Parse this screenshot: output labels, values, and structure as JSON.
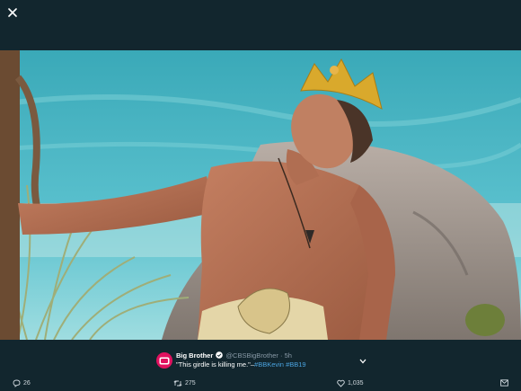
{
  "topbar": {
    "close_icon": "close-icon"
  },
  "tweet": {
    "author_name": "Big Brother",
    "handle": "@CBSBigBrother",
    "separator": "·",
    "time": "5h",
    "text": "\"This girdle is killing me.\"–",
    "hashtags": [
      "#BBKevin",
      "#BB19"
    ],
    "avatar_icon": "tv-logo-icon",
    "verified_icon": "verified-badge-icon",
    "menu_icon": "chevron-down-icon"
  },
  "actions": {
    "reply_count": "26",
    "retweet_count": "275",
    "like_count": "1,035",
    "reply_icon": "reply-icon",
    "retweet_icon": "retweet-icon",
    "like_icon": "heart-icon",
    "message_icon": "envelope-icon"
  },
  "colors": {
    "background": "#12262e",
    "avatar": "#e0115f",
    "hashtag": "#4aa3df",
    "secondary_text": "#8899a6"
  }
}
